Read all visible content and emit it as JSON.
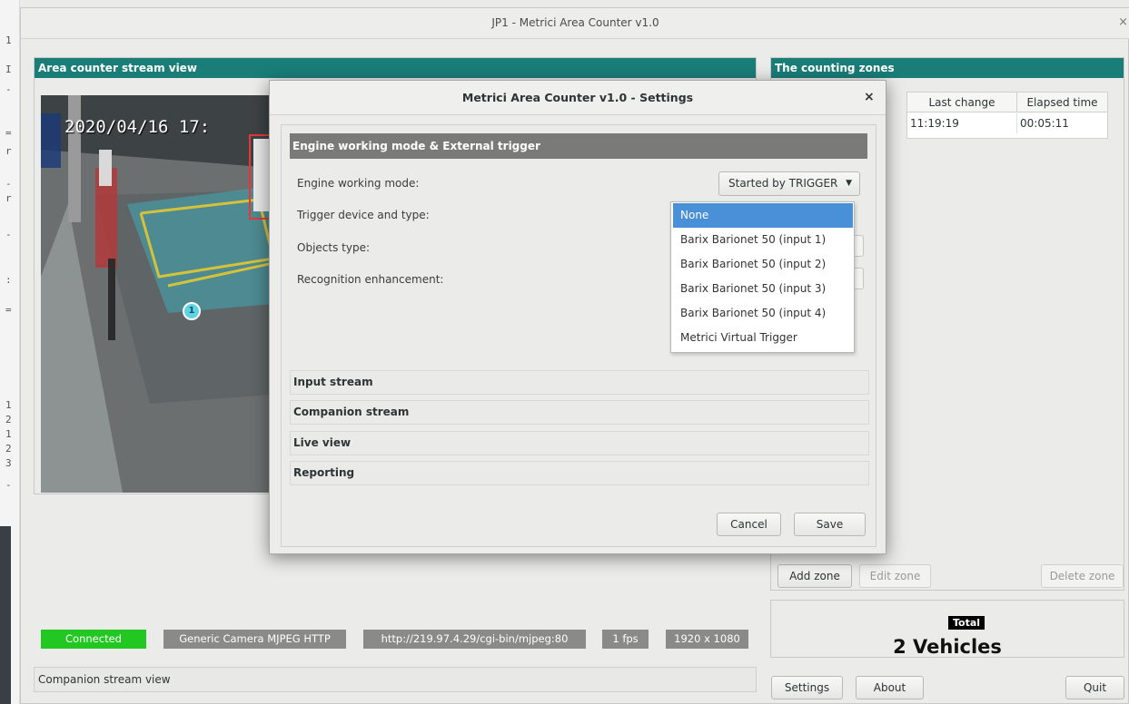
{
  "window": {
    "title": "JP1 - Metrici Area Counter v1.0",
    "close_glyph": "×"
  },
  "gutter_chars": [
    "1",
    "I",
    "-",
    "=",
    "r",
    "-",
    "r",
    "-",
    ":",
    "=",
    "1",
    "2",
    "1",
    "2",
    "3",
    "-"
  ],
  "left": {
    "header": "Area counter stream view",
    "overlay_timestamp": "2020/04/16 17:",
    "zone_marker": "1",
    "status": {
      "connected": "Connected",
      "camera_type": "Generic Camera MJPEG HTTP",
      "url": "http://219.97.4.29/cgi-bin/mjpeg:80",
      "fps": "1 fps",
      "resolution": "1920 x 1080"
    },
    "companion_header": "Companion stream view"
  },
  "right": {
    "header": "The counting zones",
    "table": {
      "columns": [
        "Last change",
        "Elapsed time"
      ],
      "rows": [
        [
          "11:19:19",
          "00:05:11"
        ]
      ]
    },
    "buttons": {
      "add_zone": "Add zone",
      "edit_zone": "Edit zone",
      "delete_zone": "Delete zone"
    },
    "total_label": "Total",
    "total_value": "2 Vehicles"
  },
  "bottom_buttons": {
    "settings": "Settings",
    "about": "About",
    "quit": "Quit"
  },
  "dialog": {
    "title": "Metrici Area Counter v1.0 - Settings",
    "close": "×",
    "section_engine": "Engine working mode & External trigger",
    "fields": {
      "engine_mode_label": "Engine working mode:",
      "engine_mode_value": "Started by TRIGGER",
      "trigger_label": "Trigger device and type:",
      "objects_label": "Objects type:",
      "recognition_label": "Recognition enhancement:"
    },
    "trigger_options": [
      "None",
      "Barix Barionet 50 (input 1)",
      "Barix Barionet 50 (input 2)",
      "Barix Barionet 50 (input 3)",
      "Barix Barionet 50 (input 4)",
      "Metrici Virtual Trigger"
    ],
    "selected_option_index": 0,
    "sections": [
      "Input stream",
      "Companion stream",
      "Live view",
      "Reporting"
    ],
    "buttons": {
      "cancel": "Cancel",
      "save": "Save"
    }
  },
  "colors": {
    "header_teal": "#1a7d78",
    "connected_green": "#22c722",
    "badge_gray": "#8a8a88",
    "selection_blue": "#4a90d9"
  }
}
